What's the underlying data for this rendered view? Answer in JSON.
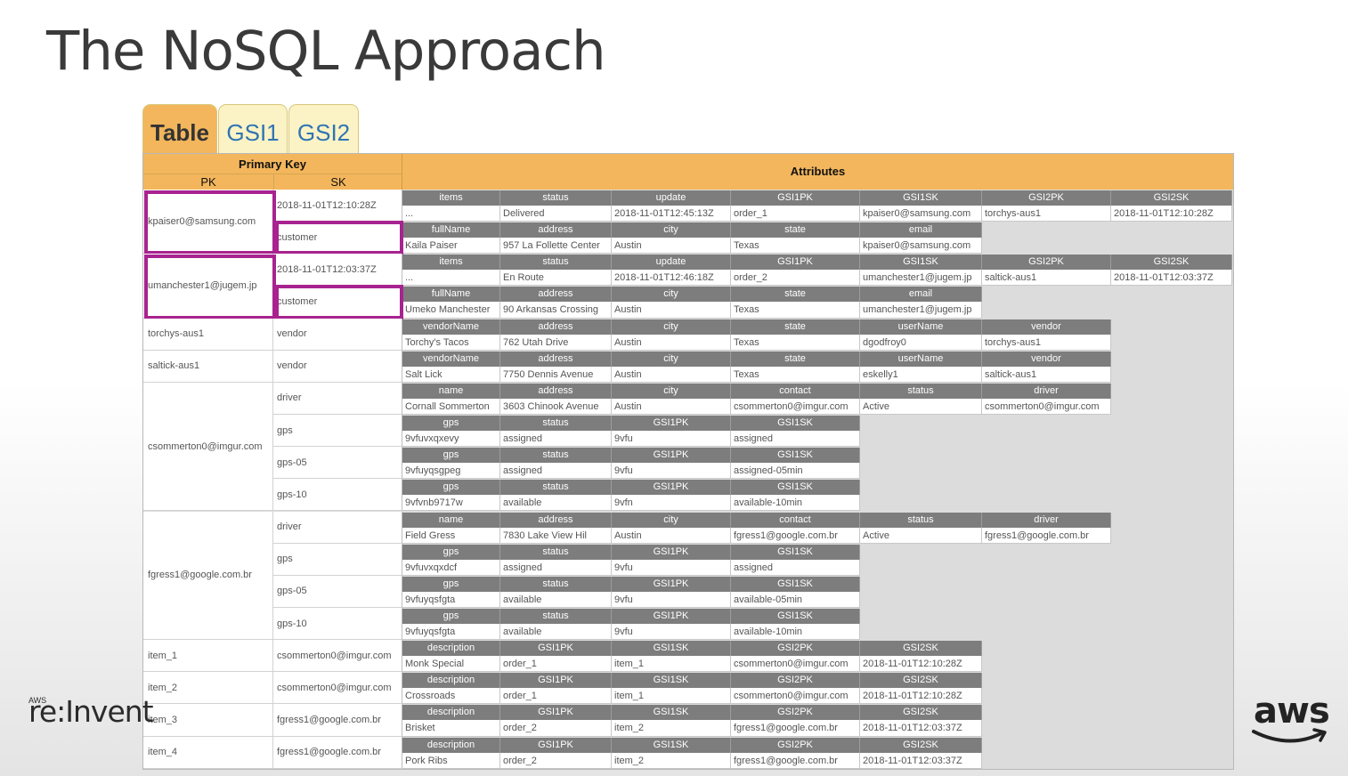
{
  "title": "The NoSQL Approach",
  "tabs": [
    "Table",
    "GSI1",
    "GSI2"
  ],
  "header": {
    "primary_key": "Primary Key",
    "pk": "PK",
    "sk": "SK",
    "attributes": "Attributes"
  },
  "colors": {
    "orange": "#f3b65c",
    "tab_inactive": "#fbf3c6",
    "tab_text": "#2f74b2",
    "highlight": "#a8238f",
    "attr_header": "#7d7d7d"
  },
  "partitions": [
    {
      "pk": "kpaiser0@samsung.com",
      "highlighted": true,
      "items": [
        {
          "sk": "2018-11-01T12:10:28Z",
          "names": [
            "items",
            "status",
            "update",
            "GSI1PK",
            "GSI1SK",
            "GSI2PK",
            "GSI2SK"
          ],
          "values": [
            "...",
            "Delivered",
            "2018-11-01T12:45:13Z",
            "order_1",
            "kpaiser0@samsung.com",
            "torchys-aus1",
            "2018-11-01T12:10:28Z"
          ]
        },
        {
          "sk": "customer",
          "highlighted": true,
          "names": [
            "fullName",
            "address",
            "city",
            "state",
            "email"
          ],
          "values": [
            "Kaila Paiser",
            "957 La Follette Center",
            "Austin",
            "Texas",
            "kpaiser0@samsung.com"
          ]
        }
      ]
    },
    {
      "pk": "umanchester1@jugem.jp",
      "highlighted": true,
      "items": [
        {
          "sk": "2018-11-01T12:03:37Z",
          "names": [
            "items",
            "status",
            "update",
            "GSI1PK",
            "GSI1SK",
            "GSI2PK",
            "GSI2SK"
          ],
          "values": [
            "...",
            "En Route",
            "2018-11-01T12:46:18Z",
            "order_2",
            "umanchester1@jugem.jp",
            "saltick-aus1",
            "2018-11-01T12:03:37Z"
          ]
        },
        {
          "sk": "customer",
          "highlighted": true,
          "names": [
            "fullName",
            "address",
            "city",
            "state",
            "email"
          ],
          "values": [
            "Umeko Manchester",
            "90 Arkansas Crossing",
            "Austin",
            "Texas",
            "umanchester1@jugem.jp"
          ]
        }
      ]
    },
    {
      "pk": "torchys-aus1",
      "items": [
        {
          "sk": "vendor",
          "names": [
            "vendorName",
            "address",
            "city",
            "state",
            "userName",
            "vendor"
          ],
          "values": [
            "Torchy's Tacos",
            "762 Utah Drive",
            "Austin",
            "Texas",
            "dgodfroy0",
            "torchys-aus1"
          ]
        }
      ]
    },
    {
      "pk": "saltick-aus1",
      "items": [
        {
          "sk": "vendor",
          "names": [
            "vendorName",
            "address",
            "city",
            "state",
            "userName",
            "vendor"
          ],
          "values": [
            "Salt Lick",
            "7750 Dennis Avenue",
            "Austin",
            "Texas",
            "eskelly1",
            "saltick-aus1"
          ]
        }
      ]
    },
    {
      "pk": "csommerton0@imgur.com",
      "items": [
        {
          "sk": "driver",
          "names": [
            "name",
            "address",
            "city",
            "contact",
            "status",
            "driver"
          ],
          "values": [
            "Cornall Sommerton",
            "3603 Chinook Avenue",
            "Austin",
            "csommerton0@imgur.com",
            "Active",
            "csommerton0@imgur.com"
          ]
        },
        {
          "sk": "gps",
          "names": [
            "gps",
            "status",
            "GSI1PK",
            "GSI1SK"
          ],
          "values": [
            "9vfuvxqxevy",
            "assigned",
            "9vfu",
            "assigned"
          ]
        },
        {
          "sk": "gps-05",
          "names": [
            "gps",
            "status",
            "GSI1PK",
            "GSI1SK"
          ],
          "values": [
            "9vfuyqsgpeg",
            "assigned",
            "9vfu",
            "assigned-05min"
          ]
        },
        {
          "sk": "gps-10",
          "names": [
            "gps",
            "status",
            "GSI1PK",
            "GSI1SK"
          ],
          "values": [
            "9vfvnb9717w",
            "available",
            "9vfn",
            "available-10min"
          ]
        }
      ]
    },
    {
      "pk": "fgress1@google.com.br",
      "items": [
        {
          "sk": "driver",
          "names": [
            "name",
            "address",
            "city",
            "contact",
            "status",
            "driver"
          ],
          "values": [
            "Field Gress",
            "7830 Lake View Hil",
            "Austin",
            "fgress1@google.com.br",
            "Active",
            "fgress1@google.com.br"
          ]
        },
        {
          "sk": "gps",
          "names": [
            "gps",
            "status",
            "GSI1PK",
            "GSI1SK"
          ],
          "values": [
            "9vfuvxqxdcf",
            "assigned",
            "9vfu",
            "assigned"
          ]
        },
        {
          "sk": "gps-05",
          "names": [
            "gps",
            "status",
            "GSI1PK",
            "GSI1SK"
          ],
          "values": [
            "9vfuyqsfgta",
            "available",
            "9vfu",
            "available-05min"
          ]
        },
        {
          "sk": "gps-10",
          "names": [
            "gps",
            "status",
            "GSI1PK",
            "GSI1SK"
          ],
          "values": [
            "9vfuyqsfgta",
            "available",
            "9vfu",
            "available-10min"
          ]
        }
      ]
    },
    {
      "pk": "item_1",
      "items": [
        {
          "sk": "csommerton0@imgur.com",
          "names": [
            "description",
            "GSI1PK",
            "GSI1SK",
            "GSI2PK",
            "GSI2SK"
          ],
          "values": [
            "Monk Special",
            "order_1",
            "item_1",
            "csommerton0@imgur.com",
            "2018-11-01T12:10:28Z"
          ]
        }
      ]
    },
    {
      "pk": "item_2",
      "items": [
        {
          "sk": "csommerton0@imgur.com",
          "names": [
            "description",
            "GSI1PK",
            "GSI1SK",
            "GSI2PK",
            "GSI2SK"
          ],
          "values": [
            "Crossroads",
            "order_1",
            "item_1",
            "csommerton0@imgur.com",
            "2018-11-01T12:10:28Z"
          ]
        }
      ]
    },
    {
      "pk": "item_3",
      "items": [
        {
          "sk": "fgress1@google.com.br",
          "names": [
            "description",
            "GSI1PK",
            "GSI1SK",
            "GSI2PK",
            "GSI2SK"
          ],
          "values": [
            "Brisket",
            "order_2",
            "item_2",
            "fgress1@google.com.br",
            "2018-11-01T12:03:37Z"
          ]
        }
      ]
    },
    {
      "pk": "item_4",
      "items": [
        {
          "sk": "fgress1@google.com.br",
          "names": [
            "description",
            "GSI1PK",
            "GSI1SK",
            "GSI2PK",
            "GSI2SK"
          ],
          "values": [
            "Pork Ribs",
            "order_2",
            "item_2",
            "fgress1@google.com.br",
            "2018-11-01T12:03:37Z"
          ]
        }
      ]
    }
  ],
  "branding": {
    "reinvent_small": "AWS",
    "reinvent": "re:Invent",
    "aws": "aws"
  }
}
